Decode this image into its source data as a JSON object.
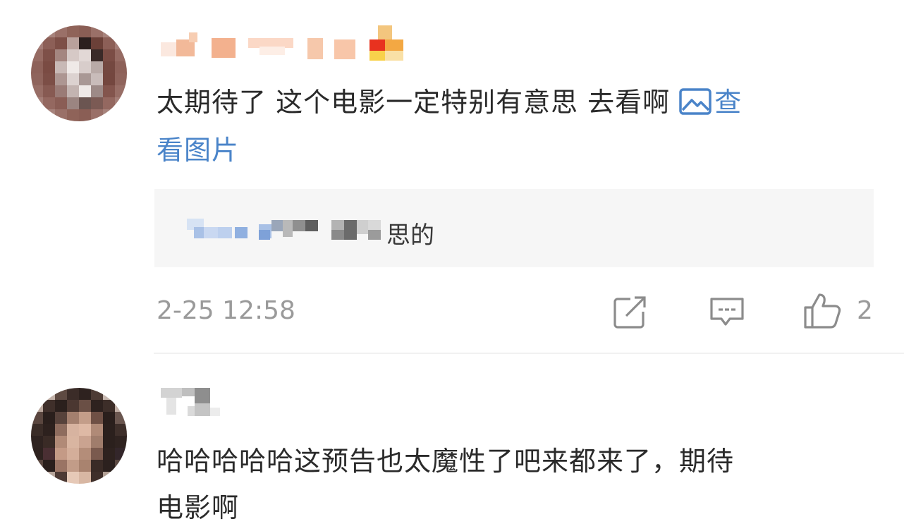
{
  "comments": [
    {
      "text_line1": "太期待了 这个电影一定特别有意思 去看啊 ",
      "link_icon": "image-icon",
      "link_part1": "查",
      "link_part2": "看图片",
      "reply": {
        "visible_tail": "思的"
      },
      "time": "2-25 12:58",
      "actions": {
        "share_icon": "share-icon",
        "comment_icon": "comment-icon",
        "like_icon": "thumbs-up-icon",
        "like_count": "2"
      }
    },
    {
      "text_line1": "哈哈哈哈哈这预告也太魔性了吧来都来了，期待",
      "text_line2": "电影啊"
    }
  ],
  "colors": {
    "link": "#4a84c9",
    "muted": "#9a9a9a",
    "reply_bg": "#f6f6f6"
  }
}
